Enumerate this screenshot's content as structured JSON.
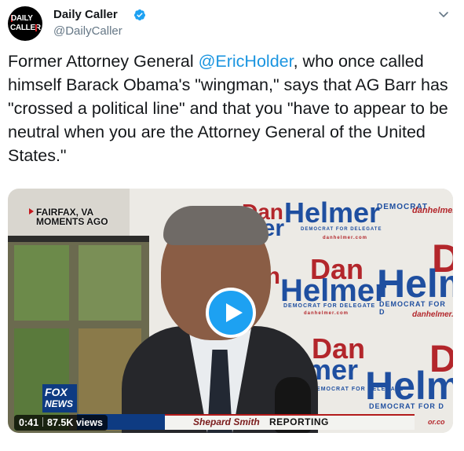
{
  "account": {
    "avatar_text_line1": "DAILY",
    "avatar_text_line2": "CALLER",
    "display_name": "Daily Caller",
    "handle": "@DailyCaller",
    "verified": true
  },
  "tweet": {
    "text_before": "Former Attorney General ",
    "mention": "@EricHolder",
    "text_after": ", who once called himself Barack Obama's \"wingman,\" says that AG Barr has \"crossed a political line\" and that you \"have to appear to be neutral when you are the Attorney General of the United States.\""
  },
  "video": {
    "location_line1": "FAIRFAX, VA",
    "location_line2": "MOMENTS AGO",
    "network_line1": "FOX",
    "network_line2": "NEWS",
    "anchor_name": "Shepard Smith",
    "anchor_suffix": "REPORTING",
    "duration": "0:41",
    "views": "87.5K views",
    "poster_texts": {
      "dan": "Dan",
      "helmer": "Helmer",
      "helm": "Helm",
      "d": "D",
      "democrat_for_delegate": "DEMOCRAT FOR DELEGATE",
      "democrat_for_d": "DEMOCRAT FOR D",
      "democrat": "DEMOCRAT",
      "site": "danhelmer.com",
      "site_short": "danhelmer.co",
      "site_frag": "danhelmer.",
      "mer": "mer",
      "er": "er",
      "an": "an",
      "or_co": "or.co"
    }
  },
  "colors": {
    "link": "#1b95e0",
    "play_button": "#1da1f2",
    "verified_badge": "#1da1f2",
    "handle_gray": "#657786"
  },
  "icons": {
    "verified": "verified-badge-icon",
    "caret": "chevron-down-icon",
    "play": "play-icon"
  }
}
